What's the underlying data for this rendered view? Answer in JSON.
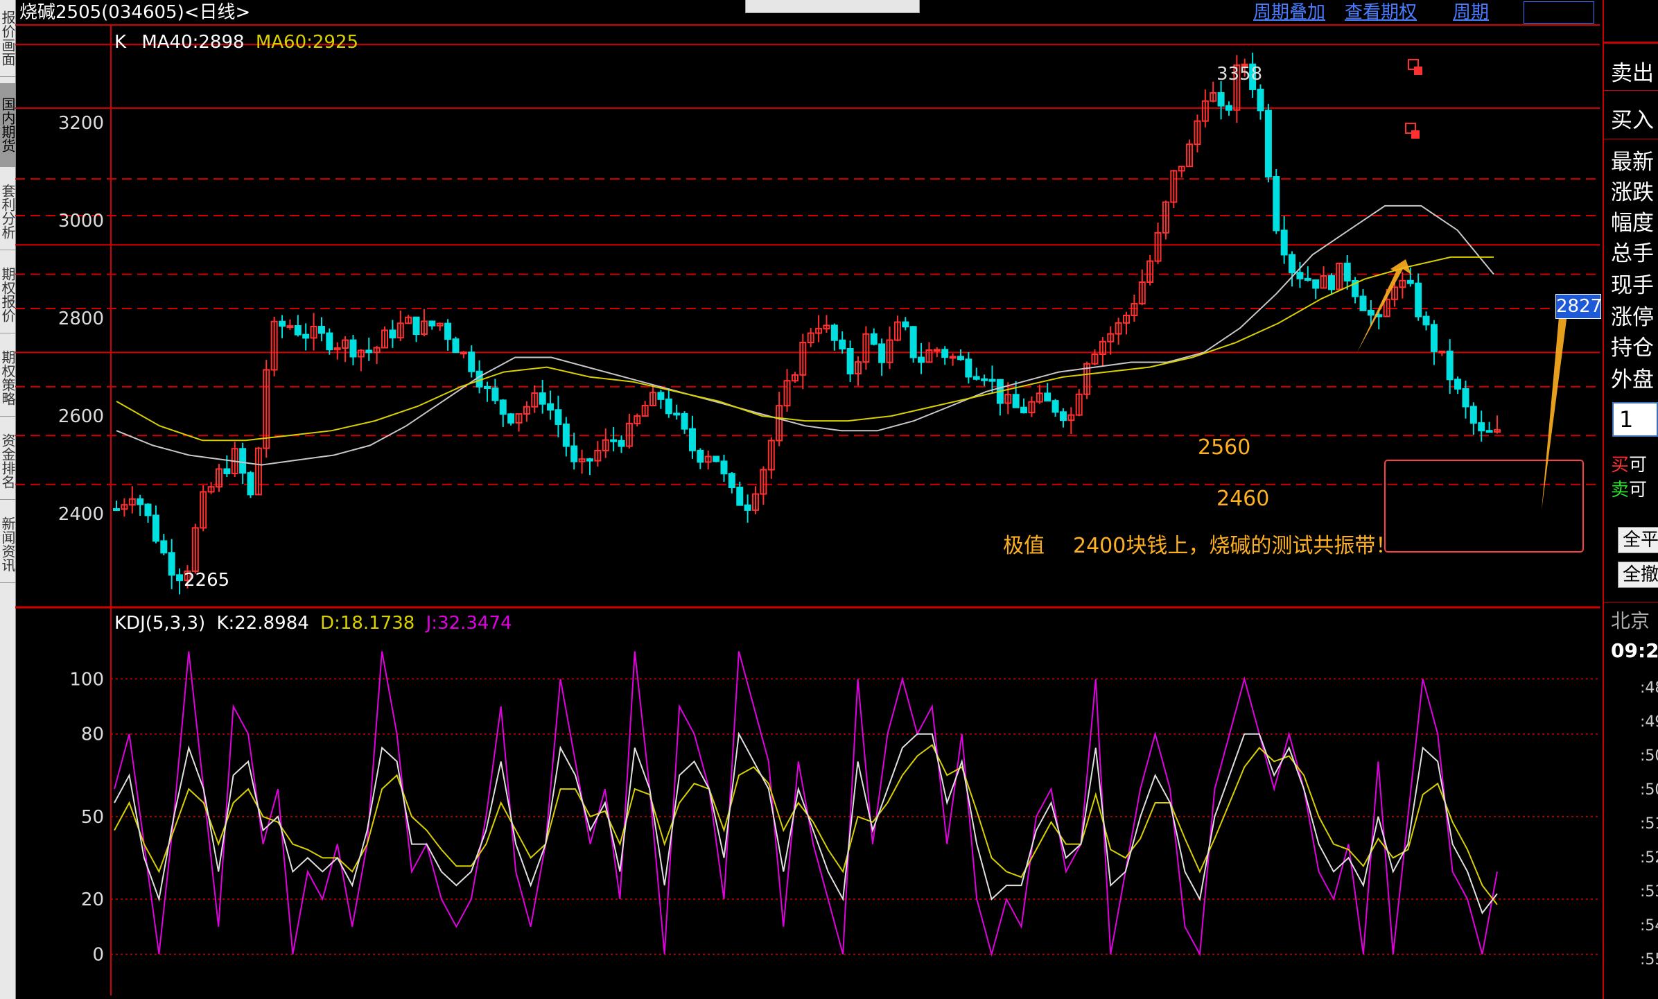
{
  "window": {
    "title": "烧碱2505(034605)<日线>",
    "links": [
      "周期叠加",
      "查看期权",
      "周期"
    ]
  },
  "left_tabs": [
    "报价画面",
    "国内期货",
    "套利分析",
    "期权报价",
    "期权策略",
    "资金排名",
    "新闻资讯"
  ],
  "right_panel": {
    "labels": [
      "卖出",
      "买入",
      "最新",
      "涨跌",
      "幅度",
      "总手",
      "现手",
      "涨停",
      "持仓",
      "外盘"
    ],
    "quantity": "1",
    "buy_label": "买",
    "sell_label": "卖",
    "avail": "可",
    "buttons": [
      "全平",
      "全撤"
    ],
    "time_label": "北京",
    "time": "09:2",
    "time_ticks": [
      ":48",
      ":49",
      ":50",
      ":50",
      ":51",
      ":52",
      ":53",
      ":54",
      ":55"
    ]
  },
  "colors": {
    "background": "#000000",
    "grid_red": "#d40000",
    "candle_up": "#ff3030",
    "candle_down": "#00e0e0",
    "ma40": "#c8c8c8",
    "ma60": "#d8d000",
    "kdj_k": "#e0e0e0",
    "kdj_d": "#d8d000",
    "kdj_j": "#e000e0",
    "annotation": "#ffb020"
  },
  "chart_data": [
    {
      "type": "candlestick",
      "legend": {
        "prefix": "K",
        "ma40": "MA40:2898",
        "ma60": "MA60:2925"
      },
      "yticks": [
        2400,
        2600,
        2800,
        3000,
        3200
      ],
      "ylim": [
        2220,
        3400
      ],
      "hlines_solid": [
        3360,
        3230,
        2950,
        2730
      ],
      "hlines_dashed": [
        3085,
        3010,
        2890,
        2820,
        2660,
        2560,
        2460
      ],
      "high_label": "3358",
      "low_label": "2265",
      "price_tag": "2827",
      "annotations": [
        "2560",
        "2460",
        "极值",
        "2400块钱上，烧碱的测试共振带！"
      ],
      "ohlc_waypoints": [
        2410,
        2450,
        2380,
        2300,
        2270,
        2420,
        2480,
        2520,
        2420,
        2770,
        2790,
        2770,
        2760,
        2750,
        2740,
        2730,
        2770,
        2790,
        2780,
        2790,
        2740,
        2700,
        2630,
        2600,
        2620,
        2640,
        2580,
        2480,
        2520,
        2550,
        2560,
        2620,
        2640,
        2580,
        2520,
        2530,
        2440,
        2420,
        2500,
        2620,
        2720,
        2800,
        2760,
        2690,
        2760,
        2720,
        2790,
        2710,
        2740,
        2720,
        2700,
        2690,
        2630,
        2610,
        2630,
        2620,
        2600,
        2730,
        2760,
        2790,
        2860,
        2950,
        3090,
        3150,
        3280,
        3200,
        3340,
        3250,
        3000,
        2900,
        2880,
        2870,
        2900,
        2840,
        2780,
        2880,
        2850,
        2760,
        2700,
        2620,
        2560,
        2560
      ],
      "ma40_path": [
        2570,
        2540,
        2520,
        2510,
        2500,
        2510,
        2520,
        2540,
        2580,
        2630,
        2680,
        2720,
        2720,
        2700,
        2680,
        2660,
        2640,
        2620,
        2600,
        2580,
        2570,
        2570,
        2590,
        2620,
        2650,
        2670,
        2690,
        2700,
        2710,
        2710,
        2730,
        2780,
        2850,
        2930,
        2980,
        3030,
        3030,
        2980,
        2890
      ],
      "ma60_path": [
        2630,
        2580,
        2550,
        2550,
        2560,
        2570,
        2590,
        2620,
        2660,
        2690,
        2700,
        2680,
        2670,
        2650,
        2630,
        2600,
        2590,
        2590,
        2600,
        2620,
        2640,
        2660,
        2680,
        2690,
        2700,
        2720,
        2750,
        2790,
        2840,
        2880,
        2905,
        2925,
        2925
      ]
    },
    {
      "type": "line",
      "legend": {
        "prefix": "KDJ(5,3,3)",
        "k": "K:22.8984",
        "d": "D:18.1738",
        "j": "J:32.3474"
      },
      "yticks": [
        0,
        20,
        50,
        80,
        100
      ],
      "ylim": [
        -15,
        125
      ],
      "j_values": [
        60,
        80,
        40,
        0,
        50,
        110,
        60,
        10,
        90,
        80,
        40,
        60,
        0,
        30,
        20,
        40,
        10,
        40,
        110,
        80,
        30,
        40,
        20,
        10,
        20,
        50,
        90,
        30,
        10,
        40,
        100,
        70,
        40,
        60,
        20,
        110,
        60,
        0,
        90,
        80,
        60,
        20,
        110,
        90,
        70,
        10,
        70,
        40,
        20,
        0,
        100,
        40,
        80,
        100,
        80,
        90,
        40,
        80,
        20,
        0,
        20,
        10,
        50,
        60,
        30,
        40,
        100,
        0,
        30,
        60,
        80,
        60,
        10,
        0,
        60,
        80,
        100,
        80,
        60,
        80,
        60,
        30,
        20,
        40,
        0,
        70,
        0,
        50,
        100,
        80,
        30,
        20,
        0,
        30
      ],
      "k_values": [
        55,
        65,
        35,
        20,
        50,
        75,
        60,
        30,
        65,
        70,
        45,
        50,
        30,
        35,
        30,
        35,
        25,
        45,
        75,
        70,
        40,
        40,
        30,
        25,
        30,
        45,
        70,
        40,
        25,
        40,
        75,
        65,
        45,
        55,
        30,
        75,
        60,
        25,
        65,
        70,
        60,
        35,
        80,
        70,
        60,
        30,
        60,
        45,
        30,
        20,
        70,
        45,
        60,
        75,
        80,
        80,
        55,
        70,
        40,
        20,
        25,
        25,
        45,
        55,
        35,
        40,
        75,
        25,
        30,
        50,
        65,
        55,
        30,
        20,
        50,
        65,
        80,
        80,
        65,
        75,
        60,
        40,
        30,
        35,
        25,
        50,
        30,
        40,
        75,
        70,
        40,
        30,
        15,
        22
      ],
      "d_values": [
        45,
        55,
        40,
        30,
        45,
        60,
        55,
        40,
        55,
        60,
        50,
        48,
        40,
        38,
        35,
        35,
        30,
        40,
        60,
        65,
        50,
        45,
        38,
        32,
        32,
        40,
        55,
        45,
        35,
        40,
        60,
        60,
        50,
        52,
        40,
        60,
        58,
        40,
        55,
        62,
        60,
        45,
        65,
        68,
        62,
        45,
        55,
        48,
        38,
        30,
        50,
        48,
        55,
        65,
        72,
        76,
        65,
        68,
        52,
        35,
        30,
        28,
        38,
        48,
        40,
        40,
        58,
        38,
        35,
        42,
        55,
        55,
        42,
        30,
        42,
        55,
        68,
        75,
        70,
        72,
        65,
        50,
        40,
        38,
        32,
        42,
        35,
        38,
        58,
        62,
        48,
        38,
        25,
        18
      ]
    }
  ]
}
